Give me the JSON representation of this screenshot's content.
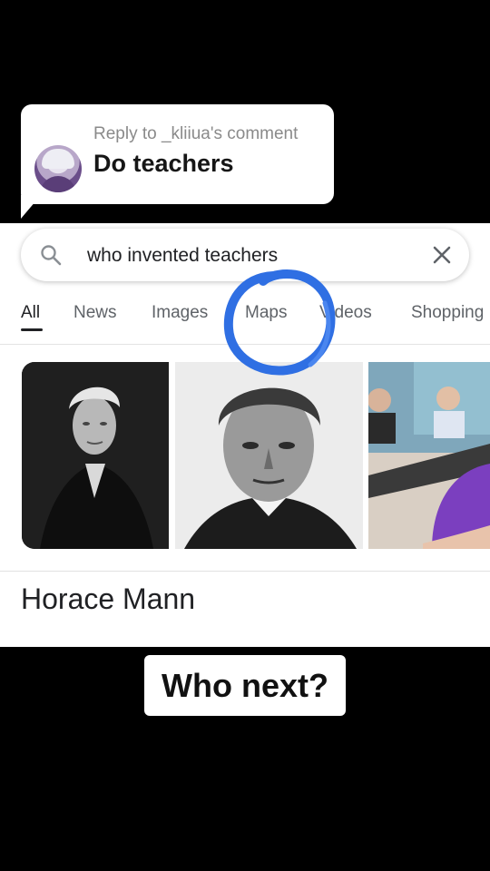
{
  "reply": {
    "reply_to": "Reply to _kliiua's comment",
    "comment": "Do teachers"
  },
  "search": {
    "query": "who invented teachers",
    "search_icon": "search-icon",
    "clear_icon": "close-icon"
  },
  "tabs": [
    "All",
    "News",
    "Images",
    "Maps",
    "Videos",
    "Shopping"
  ],
  "active_tab": "All",
  "images": [
    {
      "description_icon": "portrait-photo"
    },
    {
      "description_icon": "engraving-portrait"
    },
    {
      "description_icon": "classroom-photo"
    }
  ],
  "result": {
    "title": "Horace Mann"
  },
  "caption": "Who next?",
  "colors": {
    "scribble": "#2d6fe0",
    "text": "#202124",
    "muted": "#5f6368"
  }
}
